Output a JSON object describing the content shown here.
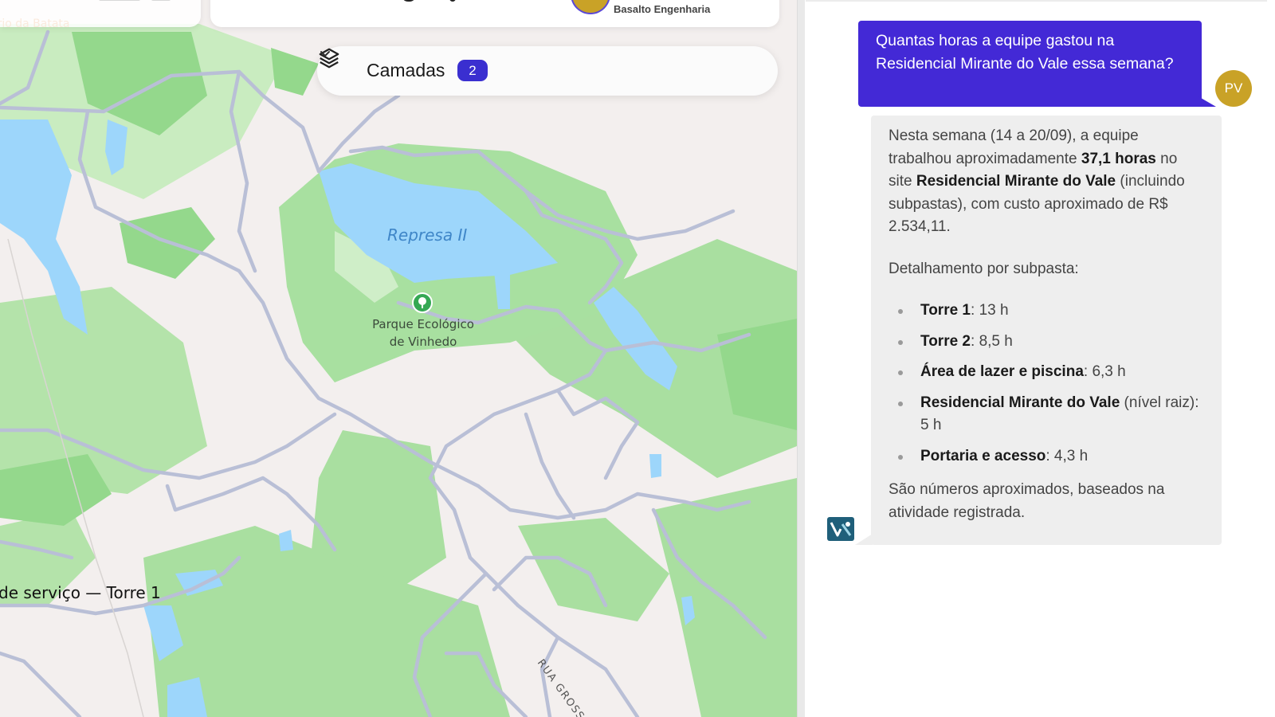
{
  "top_bar": {
    "company_name": "Basalto Engenharia"
  },
  "map": {
    "corner_label": "orio da Batata",
    "lake_label": "Represa II",
    "park_label_line1": "Parque Ecológico",
    "park_label_line2": "de Vinhedo",
    "work_label": "de serviço — Torre 1",
    "street_label": "RUA GROSSETO"
  },
  "layers": {
    "label": "Camadas",
    "count": "2"
  },
  "chat": {
    "user": {
      "avatar_initials": "PV",
      "message": "Quantas horas a equipe gastou na Residencial Mirante do Vale essa semana?"
    },
    "assistant": {
      "intro_1": "Nesta semana (14 a 20/09), a equipe trabalhou aproximadamente ",
      "hours_total": "37,1 horas",
      "intro_2": " no site ",
      "site_name": "Residencial Mirante do Vale",
      "intro_3": " (incluindo subpastas), com custo aproximado de R$ 2.534,11.",
      "breakdown_title": "Detalhamento por subpasta:",
      "items": [
        {
          "name": "Torre 1",
          "suffix": ": 13 h"
        },
        {
          "name": "Torre 2",
          "suffix": ": 8,5 h"
        },
        {
          "name": "Área de lazer e piscina",
          "suffix": ": 6,3 h"
        },
        {
          "name": "Residencial Mirante do Vale",
          "suffix": " (nível raiz): 5 h"
        },
        {
          "name": "Portaria e acesso",
          "suffix": ": 4,3 h"
        }
      ],
      "footer": "São números aproximados, baseados na atividade registrada."
    }
  },
  "colors": {
    "accent": "#4329d6",
    "avatar": "#c9a227",
    "park_green": "#a8e0a0",
    "water": "#9dd6fb",
    "road": "#b9bfd6"
  }
}
